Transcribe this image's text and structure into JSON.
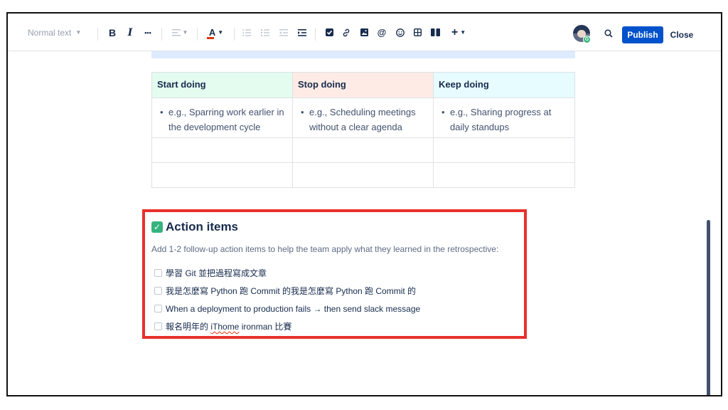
{
  "toolbar": {
    "text_style": "Normal text",
    "bold": "B",
    "italic": "I",
    "more_formatting": "•••",
    "text_color": "A",
    "add": "+",
    "publish_label": "Publish",
    "close_label": "Close"
  },
  "retro_table": {
    "headers": [
      "Start doing",
      "Stop doing",
      "Keep doing"
    ],
    "examples": [
      "e.g., Sparring work earlier in the development cycle",
      "e.g., Scheduling meetings without a clear agenda",
      "e.g., Sharing progress at daily standups"
    ]
  },
  "action_items": {
    "heading": "Action items",
    "description": "Add 1-2 follow-up action items to help the team apply what they learned in the retrospective:",
    "tasks": [
      {
        "text": "學習 Git 並把過程寫成文章",
        "checked": false
      },
      {
        "text": "我是怎麼寫 Python 跑 Commit 的我是怎麼寫 Python 跑 Commit 的",
        "checked": false
      },
      {
        "text": "When a deployment to production fails → then send slack message",
        "checked": false
      },
      {
        "text_before": "報名明年的 ",
        "text_misspelled": "iThome",
        "text_after": " ironman 比賽",
        "checked": false
      }
    ]
  },
  "colors": {
    "primary": "#0052cc",
    "highlight_border": "#e8302b",
    "start_bg": "#e3fcef",
    "stop_bg": "#ffebe6",
    "keep_bg": "#e6fcff"
  }
}
